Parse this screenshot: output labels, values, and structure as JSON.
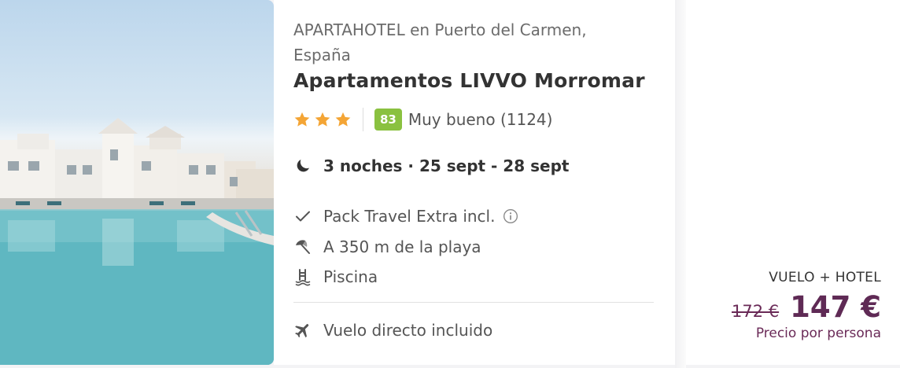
{
  "hotel": {
    "type_location": "APARTAHOTEL en Puerto del Carmen, España",
    "name": "Apartamentos LIVVO Morromar",
    "stars": 3,
    "score": "83",
    "score_text": "Muy bueno (1124)",
    "stay": "3 noches · 25 sept - 28 sept",
    "features": [
      {
        "icon": "check-icon",
        "label": "Pack Travel Extra incl."
      },
      {
        "icon": "beach-umbrella-icon",
        "label": "A 350 m de la playa"
      },
      {
        "icon": "pool-icon",
        "label": "Piscina"
      }
    ],
    "flight": {
      "icon": "plane-icon",
      "label": "Vuelo directo incluido"
    }
  },
  "price": {
    "package": "VUELO + HOTEL",
    "old_price": "172 €",
    "new_price": "147 €",
    "per_person": "Precio por persona"
  },
  "colors": {
    "score_bg": "#8ac140",
    "star": "#f4a535",
    "price": "#5f2a55"
  }
}
